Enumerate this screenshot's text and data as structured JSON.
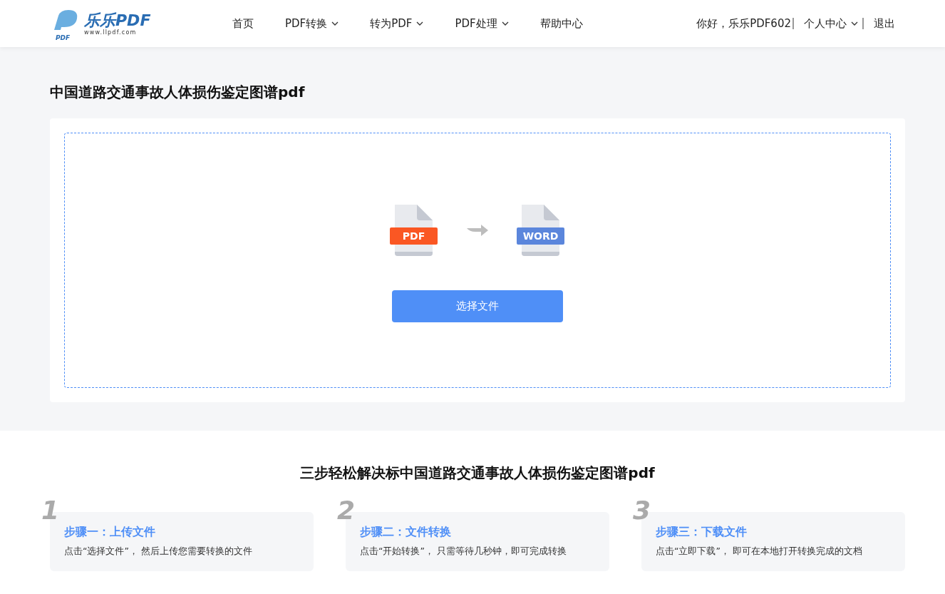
{
  "logo": {
    "badge": "PDF",
    "name": "乐乐PDF",
    "url": "www.llpdf.com"
  },
  "nav": [
    {
      "label": "首页",
      "has_menu": false
    },
    {
      "label": "PDF转换",
      "has_menu": true
    },
    {
      "label": "转为PDF",
      "has_menu": true
    },
    {
      "label": "PDF处理",
      "has_menu": true
    },
    {
      "label": "帮助中心",
      "has_menu": false
    }
  ],
  "user": {
    "greeting": "你好，乐乐PDF602",
    "account": "个人中心",
    "logout": "退出"
  },
  "page_title": "中国道路交通事故人体损伤鉴定图谱pdf",
  "upload": {
    "from_format": "PDF",
    "to_format": "WORD",
    "button": "选择文件"
  },
  "steps_title": "三步轻松解决标中国道路交通事故人体损伤鉴定图谱pdf",
  "steps": [
    {
      "number": "1",
      "title": "步骤一：上传文件",
      "text": "点击“选择文件”， 然后上传您需要转换的文件"
    },
    {
      "number": "2",
      "title": "步骤二：文件转换",
      "text": "点击“开始转换”， 只需等待几秒钟，即可完成转换"
    },
    {
      "number": "3",
      "title": "步骤三：下载文件",
      "text": "点击“立即下载”， 即可在本地打开转换完成的文档"
    }
  ]
}
